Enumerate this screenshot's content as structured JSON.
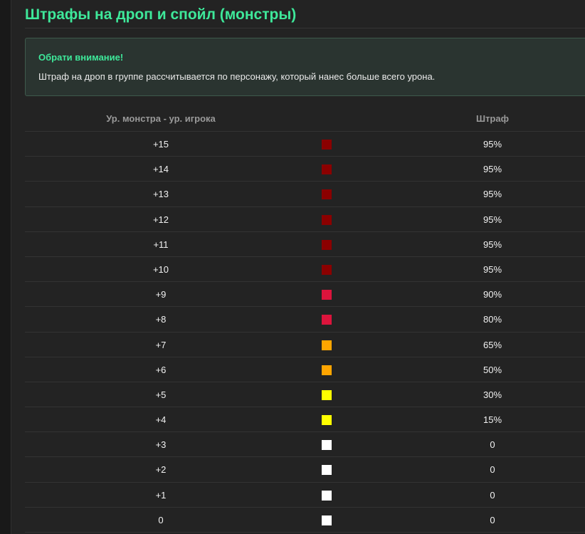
{
  "page": {
    "title": "Штрафы на дроп и спойл (монстры)"
  },
  "notice": {
    "title": "Обрати внимание!",
    "text": "Штраф на дроп в группе рассчитывается по персонажу, который нанес больше всего урона."
  },
  "table": {
    "headers": {
      "level_diff": "Ур. монстра - ур. игрока",
      "penalty": "Штраф"
    },
    "rows": [
      {
        "level": "+15",
        "penalty": "95%",
        "color": "#8b0000"
      },
      {
        "level": "+14",
        "penalty": "95%",
        "color": "#8b0000"
      },
      {
        "level": "+13",
        "penalty": "95%",
        "color": "#8b0000"
      },
      {
        "level": "+12",
        "penalty": "95%",
        "color": "#8b0000"
      },
      {
        "level": "+11",
        "penalty": "95%",
        "color": "#8b0000"
      },
      {
        "level": "+10",
        "penalty": "95%",
        "color": "#8b0000"
      },
      {
        "level": "+9",
        "penalty": "90%",
        "color": "#dc143c"
      },
      {
        "level": "+8",
        "penalty": "80%",
        "color": "#dc143c"
      },
      {
        "level": "+7",
        "penalty": "65%",
        "color": "#ffa500"
      },
      {
        "level": "+6",
        "penalty": "50%",
        "color": "#ffa500"
      },
      {
        "level": "+5",
        "penalty": "30%",
        "color": "#ffff00"
      },
      {
        "level": "+4",
        "penalty": "15%",
        "color": "#ffff00"
      },
      {
        "level": "+3",
        "penalty": "0",
        "color": "#ffffff"
      },
      {
        "level": "+2",
        "penalty": "0",
        "color": "#ffffff"
      },
      {
        "level": "+1",
        "penalty": "0",
        "color": "#ffffff"
      },
      {
        "level": "0",
        "penalty": "0",
        "color": "#ffffff"
      }
    ]
  }
}
